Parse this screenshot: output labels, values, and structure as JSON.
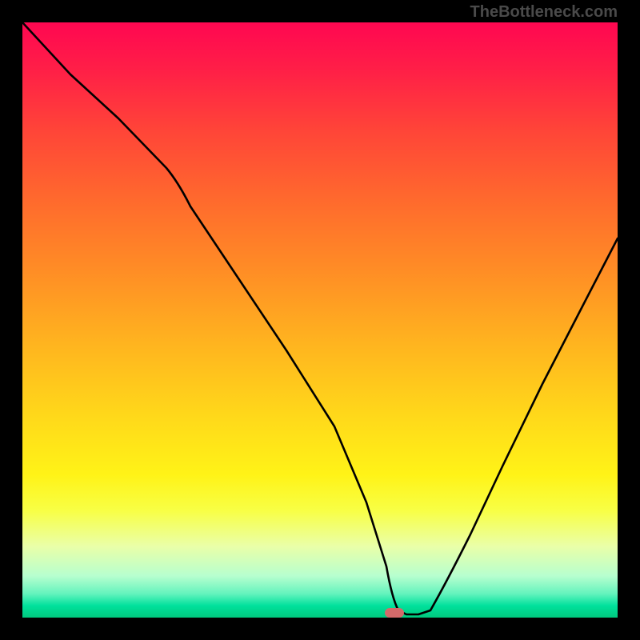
{
  "attribution": "TheBottleneck.com",
  "marker": {
    "color": "#d46a6a",
    "x_pct": 62.5,
    "y_pct": 99.2
  },
  "chart_data": {
    "type": "line",
    "title": "",
    "xlabel": "",
    "ylabel": "",
    "xlim": [
      0,
      100
    ],
    "ylim": [
      0,
      100
    ],
    "grid": false,
    "annotations": [
      "TheBottleneck.com"
    ],
    "legend": false,
    "series": [
      {
        "name": "bottleneck-curve",
        "x": [
          0,
          6,
          12,
          18,
          24,
          30,
          36,
          42,
          48,
          54,
          58,
          60,
          62,
          64,
          66,
          70,
          76,
          82,
          88,
          94,
          100
        ],
        "y": [
          100,
          92,
          85,
          77,
          68,
          60,
          51,
          42,
          33,
          22,
          12,
          5,
          1,
          0,
          1,
          6,
          16,
          28,
          40,
          52,
          64
        ]
      }
    ],
    "marker_point": {
      "x": 62.5,
      "y": 0
    },
    "background": "red-yellow-green vertical gradient (red top, green bottom)"
  }
}
